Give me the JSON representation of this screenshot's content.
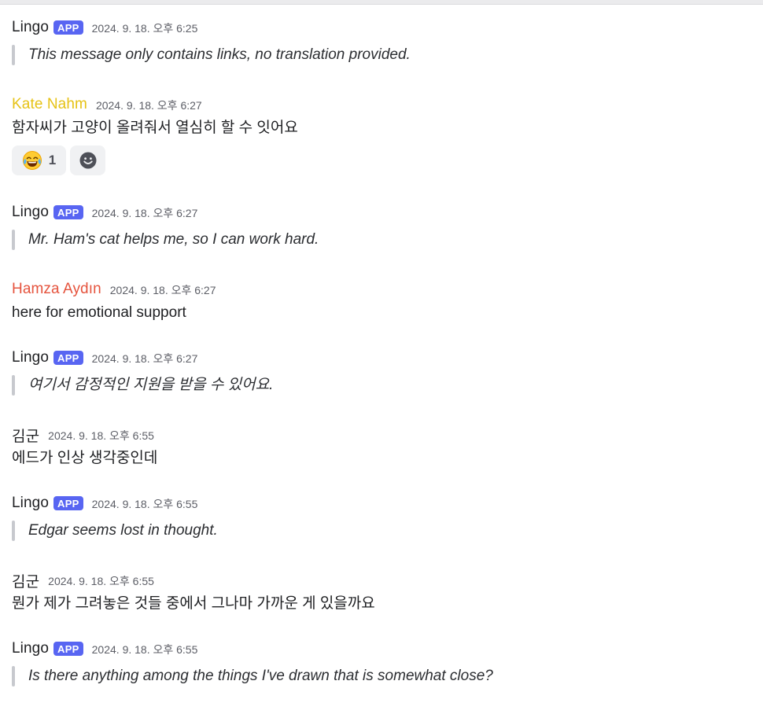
{
  "messages": [
    {
      "author": "Lingo",
      "badge": "APP",
      "timestamp": "2024. 9. 18. 오후 6:25",
      "quote": "This message only contains links, no translation provided."
    },
    {
      "author": "Kate Nahm",
      "author_color": "#e6c215",
      "timestamp": "2024. 9. 18. 오후 6:27",
      "text": "함자씨가 고양이 올려줘서 열심히 할 수 잇어요",
      "reactions": [
        {
          "emoji": "face-with-tears-of-joy",
          "count": "1"
        }
      ],
      "add_reaction_icon": "add-reaction-smiley"
    },
    {
      "author": "Lingo",
      "badge": "APP",
      "timestamp": "2024. 9. 18. 오후 6:27",
      "quote": "Mr. Ham's cat helps me, so I can work hard."
    },
    {
      "author": "Hamza Aydın",
      "author_color": "#e5533d",
      "timestamp": "2024. 9. 18. 오후 6:27",
      "text": "here for emotional support"
    },
    {
      "author": "Lingo",
      "badge": "APP",
      "timestamp": "2024. 9. 18. 오후 6:27",
      "quote": "여기서 감정적인 지원을 받을 수 있어요."
    },
    {
      "author": "김군",
      "timestamp": "2024. 9. 18. 오후 6:55",
      "text": "에드가 인상 생각중인데"
    },
    {
      "author": "Lingo",
      "badge": "APP",
      "timestamp": "2024. 9. 18. 오후 6:55",
      "quote": "Edgar seems lost in thought."
    },
    {
      "author": "김군",
      "timestamp": "2024. 9. 18. 오후 6:55",
      "text": "뭔가 제가 그려놓은 것들 중에서 그나마 가까운 게 있을까요"
    },
    {
      "author": "Lingo",
      "badge": "APP",
      "timestamp": "2024. 9. 18. 오후 6:55",
      "quote": "Is there anything among the things I've drawn that is somewhat close?"
    }
  ],
  "colors": {
    "badge_bg": "#5865f2",
    "quote_bar": "#c7c9ce",
    "reaction_bg": "#f0f1f3"
  }
}
